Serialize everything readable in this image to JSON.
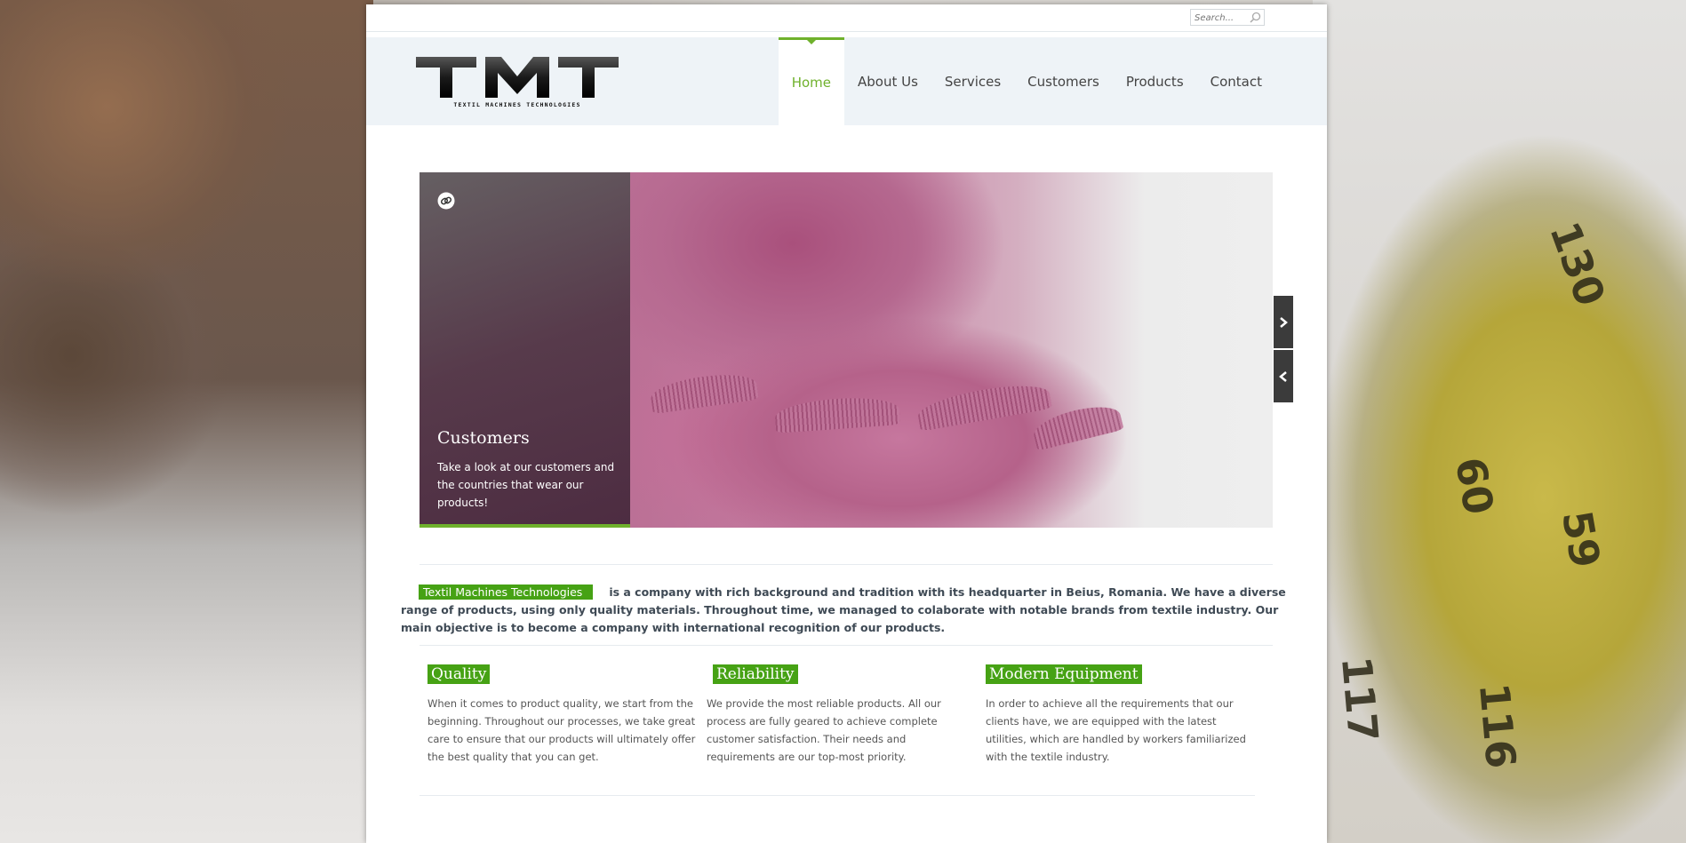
{
  "search": {
    "placeholder": "Search..."
  },
  "logo": {
    "text": "TMT",
    "subtitle": "TEXTIL MACHINES TECHNOLOGIES"
  },
  "nav": {
    "items": [
      {
        "label": "Home",
        "active": true
      },
      {
        "label": "About Us"
      },
      {
        "label": "Services"
      },
      {
        "label": "Customers"
      },
      {
        "label": "Products"
      },
      {
        "label": "Contact"
      }
    ]
  },
  "slider": {
    "caption_title": "Customers",
    "caption_text": "Take a look at our customers and the countries that wear our products!"
  },
  "intro": {
    "highlight": "Textil Machines Technologies",
    "text": "is a company with rich background and tradition with its headquarter in Beius, Romania.  We have a diverse range of products, using only quality materials. Throughout time, we managed to colaborate with notable brands from textile industry. Our main objective is to become a company with international recognition of our products."
  },
  "features": [
    {
      "title": "Quality",
      "text": "When it comes to product quality, we start from the beginning. Throughout our processes, we take great care to ensure that our products will ultimately offer the best quality that you can get."
    },
    {
      "title": "Reliability",
      "text": "We provide the most reliable products. All our process are fully geared to achieve complete customer satisfaction. Their needs and requirements are our top-most priority."
    },
    {
      "title": "Modern Equipment",
      "text": "In order to achieve all the requirements that our clients have, we are equipped with the latest utilities, which are handled by workers familiarized with the textile industry."
    }
  ],
  "colors": {
    "accent": "#6fb12c",
    "highlight_bg": "#46a214",
    "header_bg": "#eef3f7"
  }
}
